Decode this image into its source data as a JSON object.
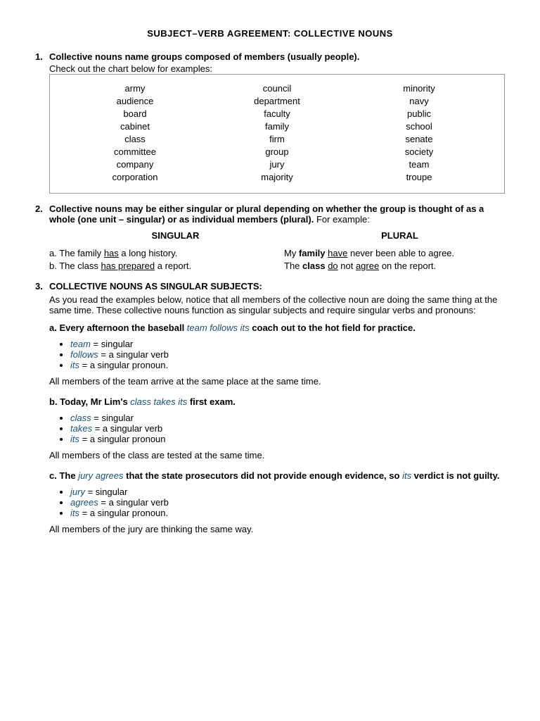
{
  "title": "SUBJECT–VERB AGREEMENT:  COLLECTIVE NOUNS",
  "section1": {
    "header": "Collective nouns name groups composed of members (usually people).",
    "subtext": "Check out the chart below for examples:",
    "chart": {
      "col1": [
        "army",
        "audience",
        "board",
        "cabinet",
        "class",
        "committee",
        "company",
        "corporation"
      ],
      "col2": [
        "council",
        "department",
        "faculty",
        "family",
        "firm",
        "group",
        "jury",
        "majority"
      ],
      "col3": [
        "minority",
        "navy",
        "public",
        "school",
        "senate",
        "society",
        "team",
        "troupe"
      ]
    }
  },
  "section2": {
    "header_bold": "Collective nouns may be either singular or plural depending on whether the group is thought of as a whole (one unit – singular) or as individual members (plural).",
    "for_example": "For example:",
    "singular_label": "SINGULAR",
    "plural_label": "PLURAL",
    "examples": [
      {
        "label": "a.",
        "singular": "The family has a long history.",
        "plural": "My family have never been able to agree."
      },
      {
        "label": "b.",
        "singular": "The class has prepared a report.",
        "plural": "The class do not agree on the report."
      }
    ]
  },
  "section3": {
    "header": "COLLECTIVE NOUNS AS SINGULAR SUBJECTS:",
    "description": "As you read the examples below, notice that all members of the collective noun are doing the same thing at the same time.  These collective nouns function as singular subjects and require singular verbs and pronouns:",
    "examples": [
      {
        "label": "a.",
        "sentence_parts": {
          "before": "Every afternoon the baseball ",
          "italic_blue": "team follows its",
          "after": " coach out to the hot field for practice."
        },
        "bullets": [
          {
            "italic": "team",
            "rest": " = singular"
          },
          {
            "italic": "follows",
            "rest": " = a singular verb"
          },
          {
            "italic": "its",
            "rest": " = a singular pronoun."
          }
        ],
        "note": "All members of the team arrive at the same place at the same time."
      },
      {
        "label": "b.",
        "sentence_parts": {
          "before": "Today, Mr Lim's ",
          "italic_blue": "class takes its",
          "after": " first exam."
        },
        "bullets": [
          {
            "italic": "class",
            "rest": " = singular"
          },
          {
            "italic": "takes",
            "rest": " = a singular verb"
          },
          {
            "italic": "its",
            "rest": " = a singular pronoun"
          }
        ],
        "note": "All members of the class are tested at the same time."
      },
      {
        "label": "c.",
        "sentence_parts": {
          "before": "The ",
          "italic_blue": "jury agrees",
          "after": " that the state prosecutors did not provide enough evidence, so ",
          "italic_blue2": "its",
          "after2": " verdict is not guilty."
        },
        "bullets": [
          {
            "italic": "jury",
            "rest": " = singular"
          },
          {
            "italic": "agrees",
            "rest": " = a singular verb"
          },
          {
            "italic": "its",
            "rest": " = a singular pronoun."
          }
        ],
        "note": "All members of the jury are thinking the same way."
      }
    ]
  }
}
